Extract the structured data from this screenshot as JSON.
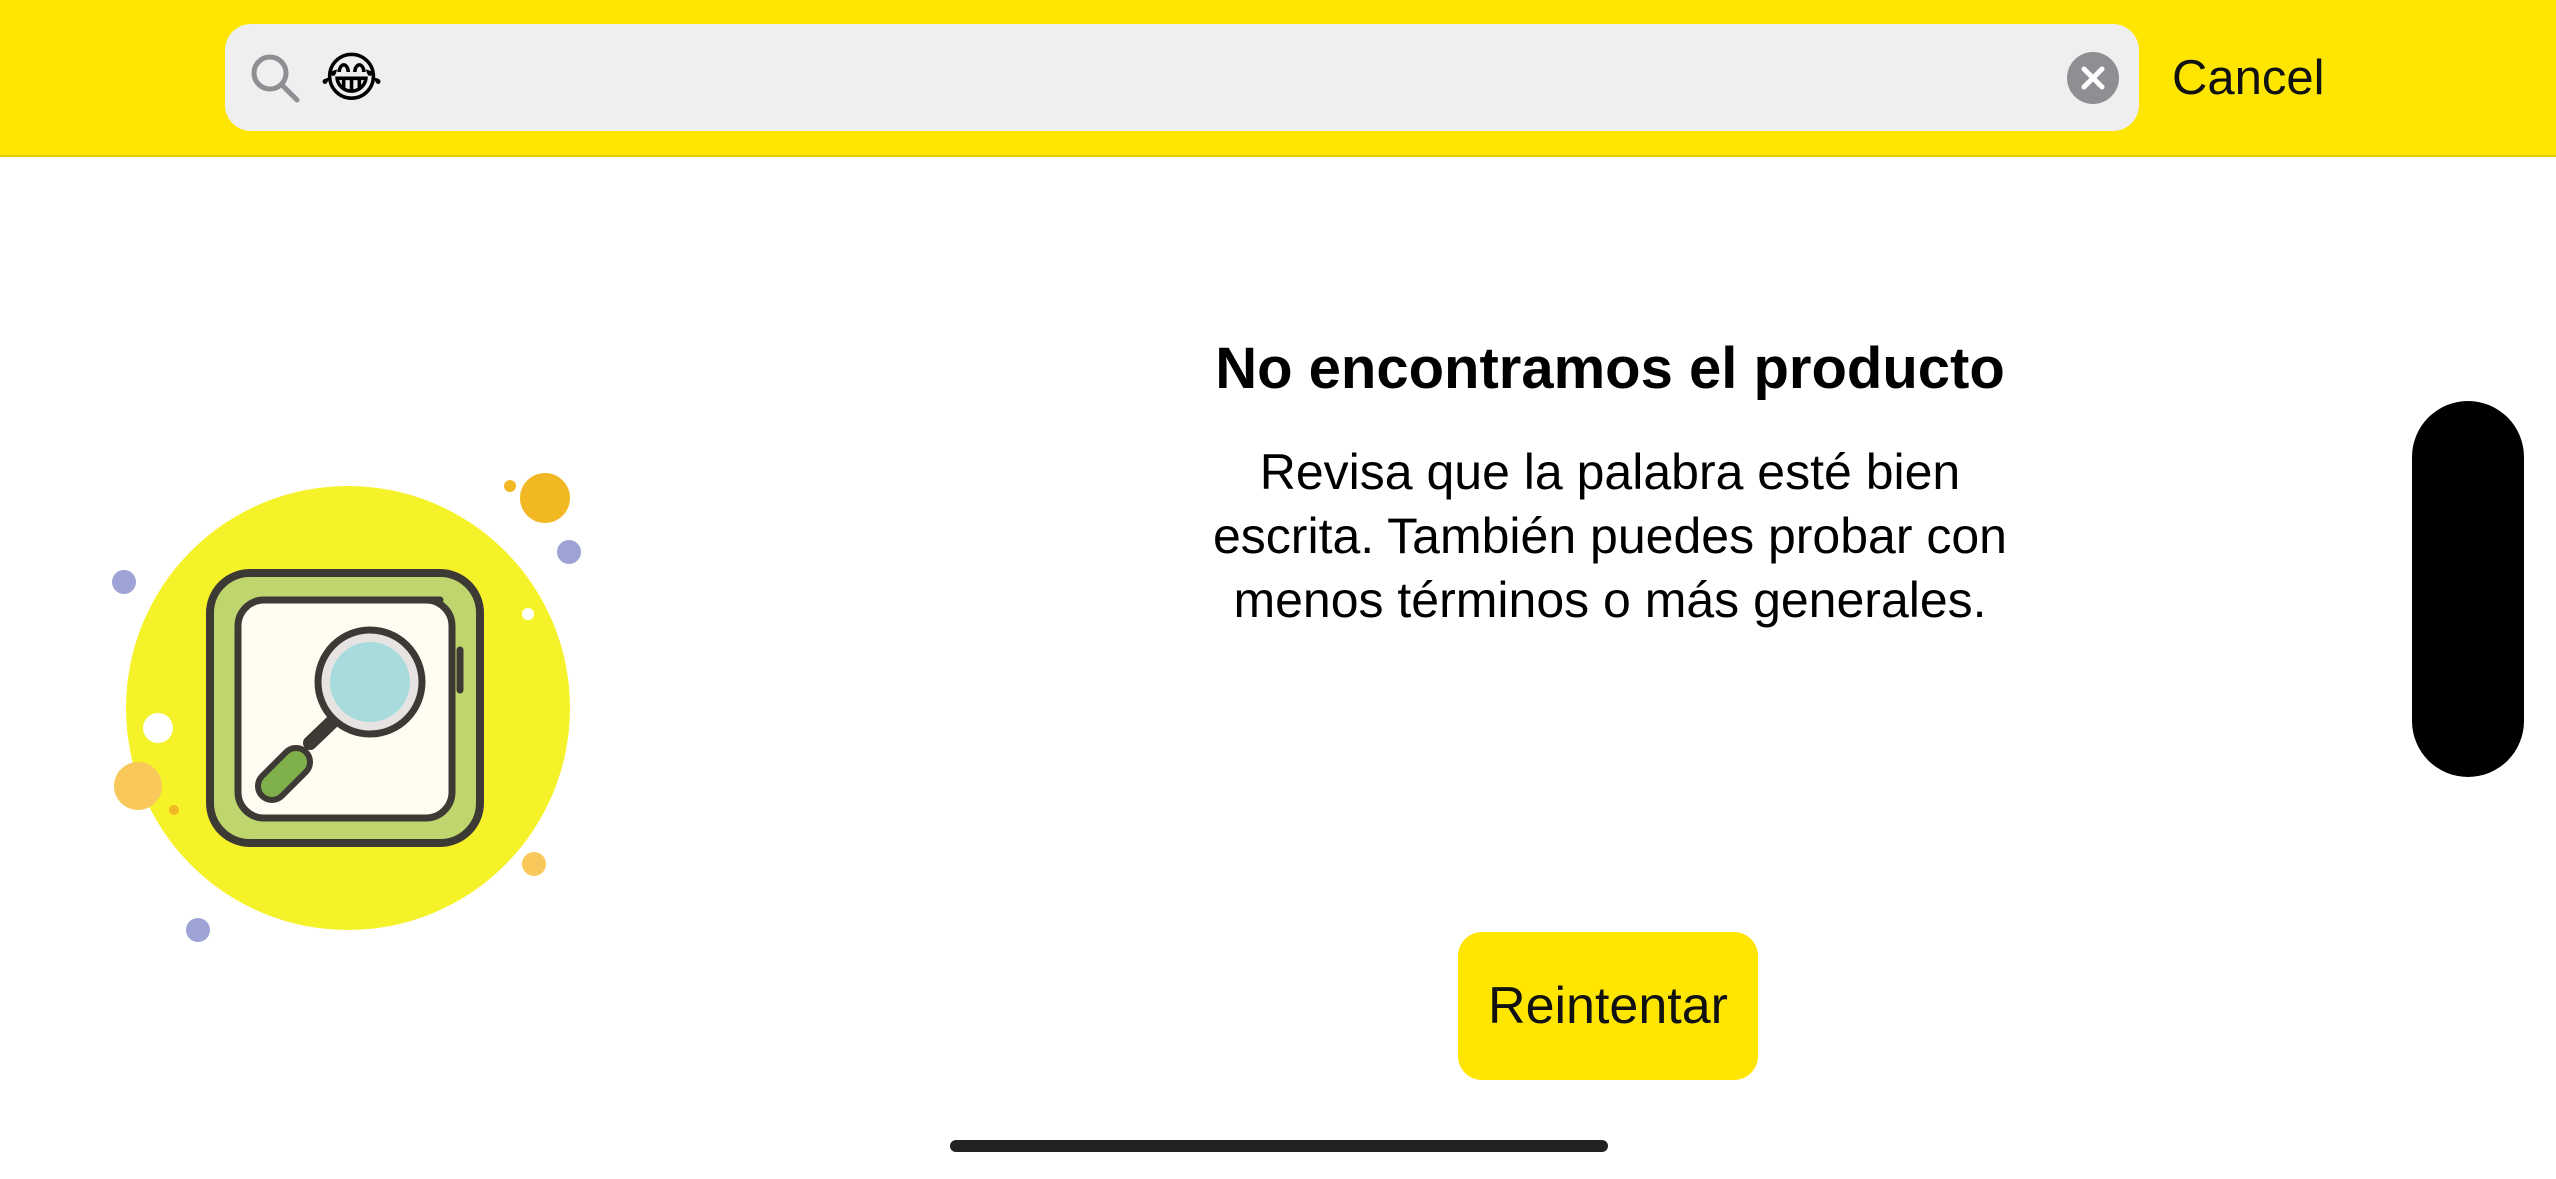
{
  "search": {
    "query": "😂",
    "cancel_label": "Cancel"
  },
  "empty_state": {
    "title": "No encontramos el producto",
    "message_lines": [
      "Revisa que la palabra esté bien",
      "escrita. También puedes probar con",
      "menos términos o más generales."
    ],
    "retry_label": "Reintentar"
  },
  "colors": {
    "accent": "#FFE600",
    "search_field": "#EFEFEF",
    "clear_button": "#8E8E93"
  },
  "icons": {
    "search": "search-icon",
    "clear": "clear-icon",
    "illustration": "magnifier-illustration"
  }
}
